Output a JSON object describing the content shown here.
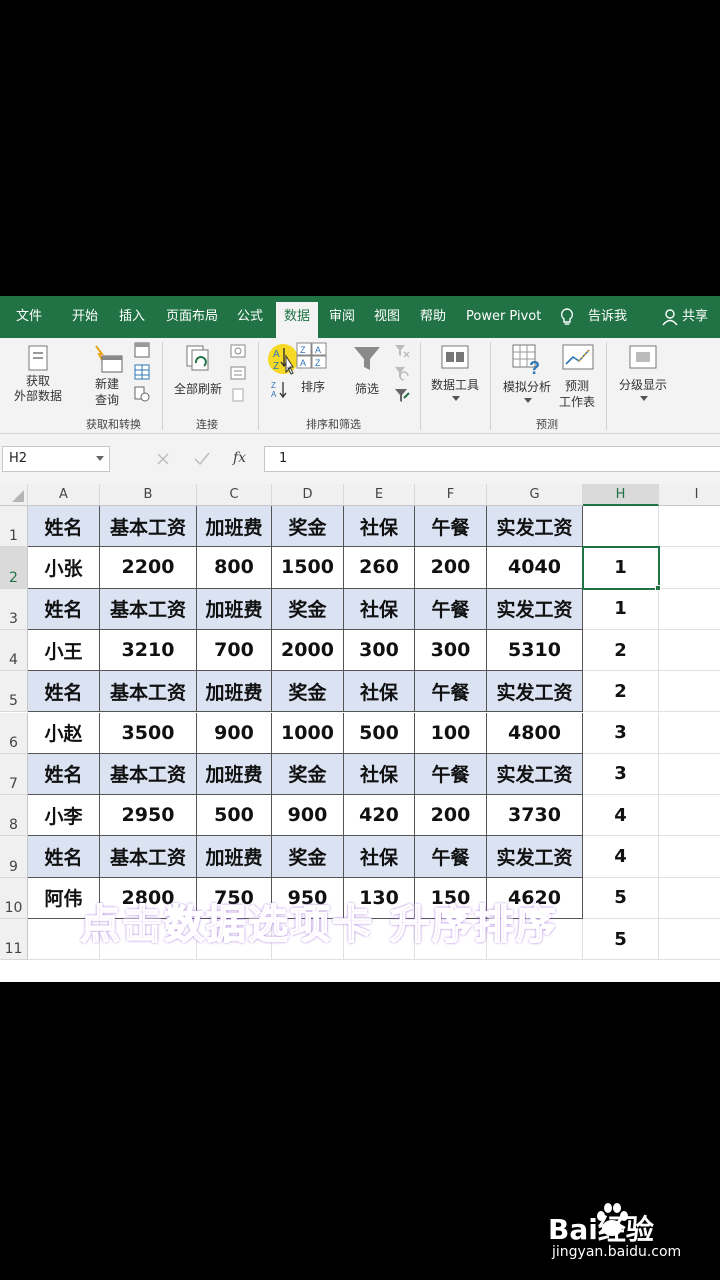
{
  "tabs": [
    "文件",
    "开始",
    "插入",
    "页面布局",
    "公式",
    "数据",
    "审阅",
    "视图",
    "帮助",
    "Power Pivot",
    "告诉我",
    "共享"
  ],
  "active_tab": "数据",
  "ribbon": {
    "get_external": "获取\n外部数据",
    "new_query": "新建\n查询",
    "group_get_transform": "获取和转换",
    "refresh_all": "全部刷新",
    "group_connections": "连接",
    "sort": "排序",
    "filter": "筛选",
    "group_sort_filter": "排序和筛选",
    "data_tools": "数据工具",
    "what_if": "模拟分析",
    "forecast_sheet": "预测\n工作表",
    "group_forecast": "预测",
    "outline": "分级显示"
  },
  "formula_bar": {
    "name_box": "H2",
    "value": "1"
  },
  "columns": [
    "A",
    "B",
    "C",
    "D",
    "E",
    "F",
    "G",
    "H",
    "I"
  ],
  "rows": [
    {
      "num": "1",
      "type": "hdr",
      "cells": [
        "姓名",
        "基本工资",
        "加班费",
        "奖金",
        "社保",
        "午餐",
        "实发工资"
      ],
      "h": ""
    },
    {
      "num": "2",
      "type": "data",
      "cells": [
        "小张",
        "2200",
        "800",
        "1500",
        "260",
        "200",
        "4040"
      ],
      "h": "1"
    },
    {
      "num": "3",
      "type": "hdr",
      "cells": [
        "姓名",
        "基本工资",
        "加班费",
        "奖金",
        "社保",
        "午餐",
        "实发工资"
      ],
      "h": "1"
    },
    {
      "num": "4",
      "type": "data",
      "cells": [
        "小王",
        "3210",
        "700",
        "2000",
        "300",
        "300",
        "5310"
      ],
      "h": "2"
    },
    {
      "num": "5",
      "type": "hdr",
      "cells": [
        "姓名",
        "基本工资",
        "加班费",
        "奖金",
        "社保",
        "午餐",
        "实发工资"
      ],
      "h": "2"
    },
    {
      "num": "6",
      "type": "data",
      "cells": [
        "小赵",
        "3500",
        "900",
        "1000",
        "500",
        "100",
        "4800"
      ],
      "h": "3"
    },
    {
      "num": "7",
      "type": "hdr",
      "cells": [
        "姓名",
        "基本工资",
        "加班费",
        "奖金",
        "社保",
        "午餐",
        "实发工资"
      ],
      "h": "3"
    },
    {
      "num": "8",
      "type": "data",
      "cells": [
        "小李",
        "2950",
        "500",
        "900",
        "420",
        "200",
        "3730"
      ],
      "h": "4"
    },
    {
      "num": "9",
      "type": "hdr",
      "cells": [
        "姓名",
        "基本工资",
        "加班费",
        "奖金",
        "社保",
        "午餐",
        "实发工资"
      ],
      "h": "4"
    },
    {
      "num": "10",
      "type": "data",
      "cells": [
        "阿伟",
        "2800",
        "750",
        "950",
        "130",
        "150",
        "4620"
      ],
      "h": "5"
    },
    {
      "num": "11",
      "type": "empty",
      "cells": [
        "",
        "",
        "",
        "",
        "",
        "",
        ""
      ],
      "h": "5"
    }
  ],
  "caption": "点击数据选项卡  升序排序",
  "watermark": {
    "brand": "Bai经验",
    "url": "jingyan.baidu.com"
  },
  "colors": {
    "excel_green": "#217346",
    "header_fill": "#dbe3f3",
    "caption": "#c9a3f0"
  }
}
